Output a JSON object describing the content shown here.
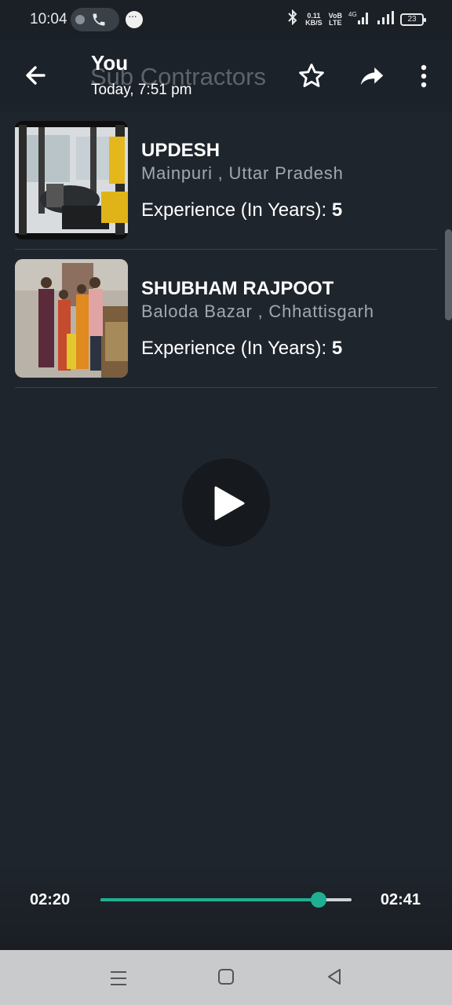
{
  "status_bar": {
    "time": "10:04",
    "net_speed_value": "0.11",
    "net_speed_unit": "KB/S",
    "volte_top": "VoB",
    "volte_bottom": "LTE",
    "network": "4G",
    "battery": "23"
  },
  "header": {
    "sender": "You",
    "timestamp": "Today, 7:51 pm",
    "background_title": "Sub Contractors"
  },
  "contractors": [
    {
      "name": "UPDESH",
      "location": "Mainpuri , Uttar Pradesh",
      "experience_label": "Experience (In Years): ",
      "experience_value": "5"
    },
    {
      "name": "SHUBHAM RAJPOOT",
      "location": "Baloda Bazar , Chhattisgarh",
      "experience_label": "Experience (In Years): ",
      "experience_value": "5"
    }
  ],
  "player": {
    "current_time": "02:20",
    "total_time": "02:41",
    "progress_fraction": 0.87,
    "accent_color": "#1fb093"
  },
  "icons": {
    "back": "arrow-left-icon",
    "star": "star-icon",
    "share": "share-icon",
    "more": "more-vert-icon",
    "play": "play-icon"
  }
}
